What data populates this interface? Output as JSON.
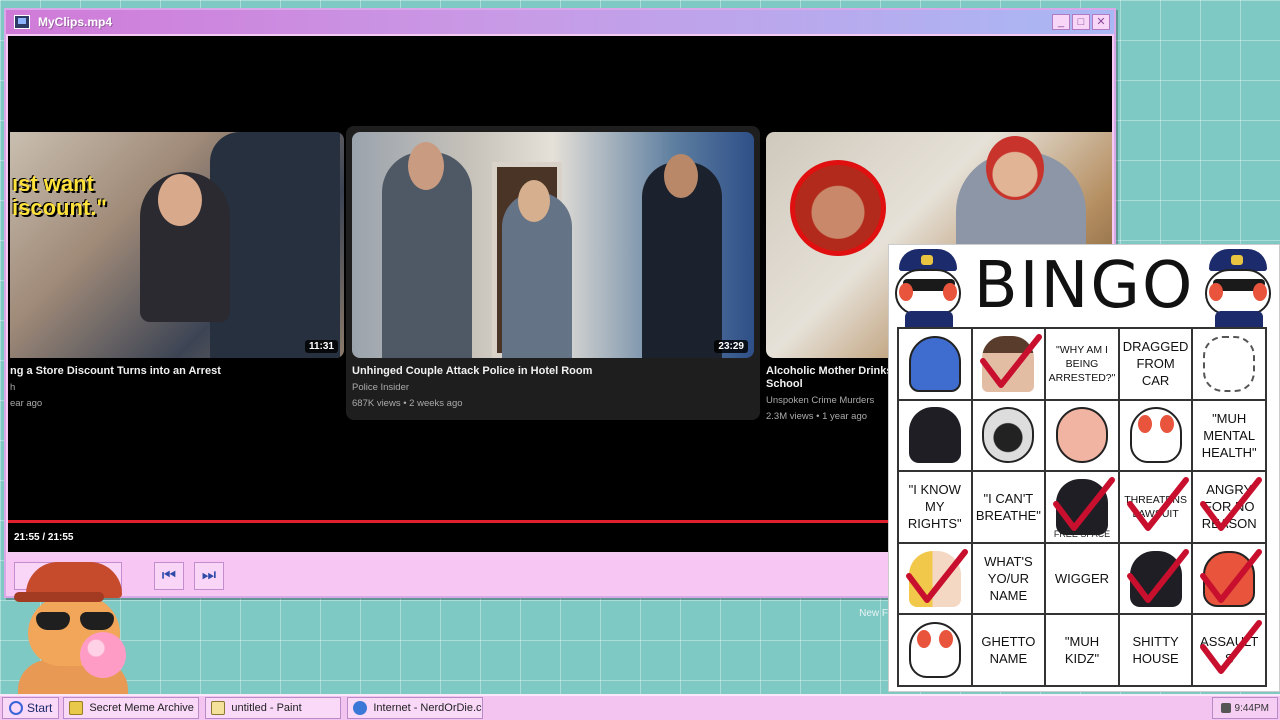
{
  "window": {
    "title": "MyClips.mp4",
    "buttons": {
      "minimize": "_",
      "maximize": "□",
      "close": "✕"
    }
  },
  "cards": [
    {
      "overlay_text": "ıst want\niscount.\"",
      "title": "ng a Store Discount Turns into an Arrest",
      "channel": "h",
      "meta": "ear ago",
      "duration": "11:31"
    },
    {
      "title": "Unhinged Couple Attack Police in Hotel Room",
      "channel": "Police Insider",
      "meta": "687K views • 2 weeks ago",
      "duration": "23:29"
    },
    {
      "title": "Alcoholic Mother Drinks I",
      "title_line2": "School",
      "channel": "Unspoken Crime Murders",
      "meta": "2.3M views • 1 year ago"
    }
  ],
  "player": {
    "time": "21:55 / 21:55",
    "progress": 1.0,
    "play_icon": "play-icon",
    "prev_icon": "skip-back-icon",
    "next_icon": "skip-forward-icon"
  },
  "desktop": {
    "label": "New F"
  },
  "bingo": {
    "title": "BINGO",
    "cells": [
      {
        "text": "",
        "art": "blue",
        "checked": false
      },
      {
        "text": "",
        "art": "woman",
        "checked": true
      },
      {
        "text": "\"Why am I being arrested?\"",
        "art": "",
        "checked": false,
        "small": true
      },
      {
        "text": "Dragged from car",
        "art": "",
        "checked": false
      },
      {
        "text": "",
        "art": "sketch",
        "checked": false
      },
      {
        "text": "",
        "art": "dark",
        "checked": false
      },
      {
        "text": "",
        "art": "gear",
        "checked": false
      },
      {
        "text": "",
        "art": "pink",
        "checked": false
      },
      {
        "text": "",
        "art": "cat",
        "checked": false
      },
      {
        "text": "\"Muh mental health\"",
        "art": "",
        "checked": false
      },
      {
        "text": "\"I know my rights\"",
        "art": "",
        "checked": false
      },
      {
        "text": "\"I can't breathe\"",
        "art": "",
        "checked": false
      },
      {
        "text": "",
        "art": "dark",
        "checked": true,
        "free": "FREE SPACE"
      },
      {
        "text": "Threatens lawsuit",
        "art": "",
        "checked": true,
        "small": true
      },
      {
        "text": "Angry for no reason",
        "art": "",
        "checked": true
      },
      {
        "text": "",
        "art": "blonde",
        "checked": true
      },
      {
        "text": "What's yo/ur name",
        "art": "",
        "checked": false
      },
      {
        "text": "Wigger",
        "art": "",
        "checked": false
      },
      {
        "text": "",
        "art": "dark",
        "checked": true
      },
      {
        "text": "",
        "art": "red",
        "checked": true
      },
      {
        "text": "",
        "art": "cat",
        "checked": false
      },
      {
        "text": "Ghetto name",
        "art": "",
        "checked": false
      },
      {
        "text": "\"Muh kidz\"",
        "art": "",
        "checked": false
      },
      {
        "text": "Shitty house",
        "art": "",
        "checked": false
      },
      {
        "text": "Assault s",
        "art": "",
        "checked": true
      }
    ],
    "check_color": "#c8102e"
  },
  "taskbar": {
    "start": "Start",
    "tasks": [
      {
        "label": "Secret Meme Archive",
        "icon": "folder"
      },
      {
        "label": "untitled - Paint",
        "icon": "paint"
      },
      {
        "label": "Internet - NerdOrDie.com",
        "icon": "ie"
      }
    ],
    "clock": "9:44PM"
  }
}
